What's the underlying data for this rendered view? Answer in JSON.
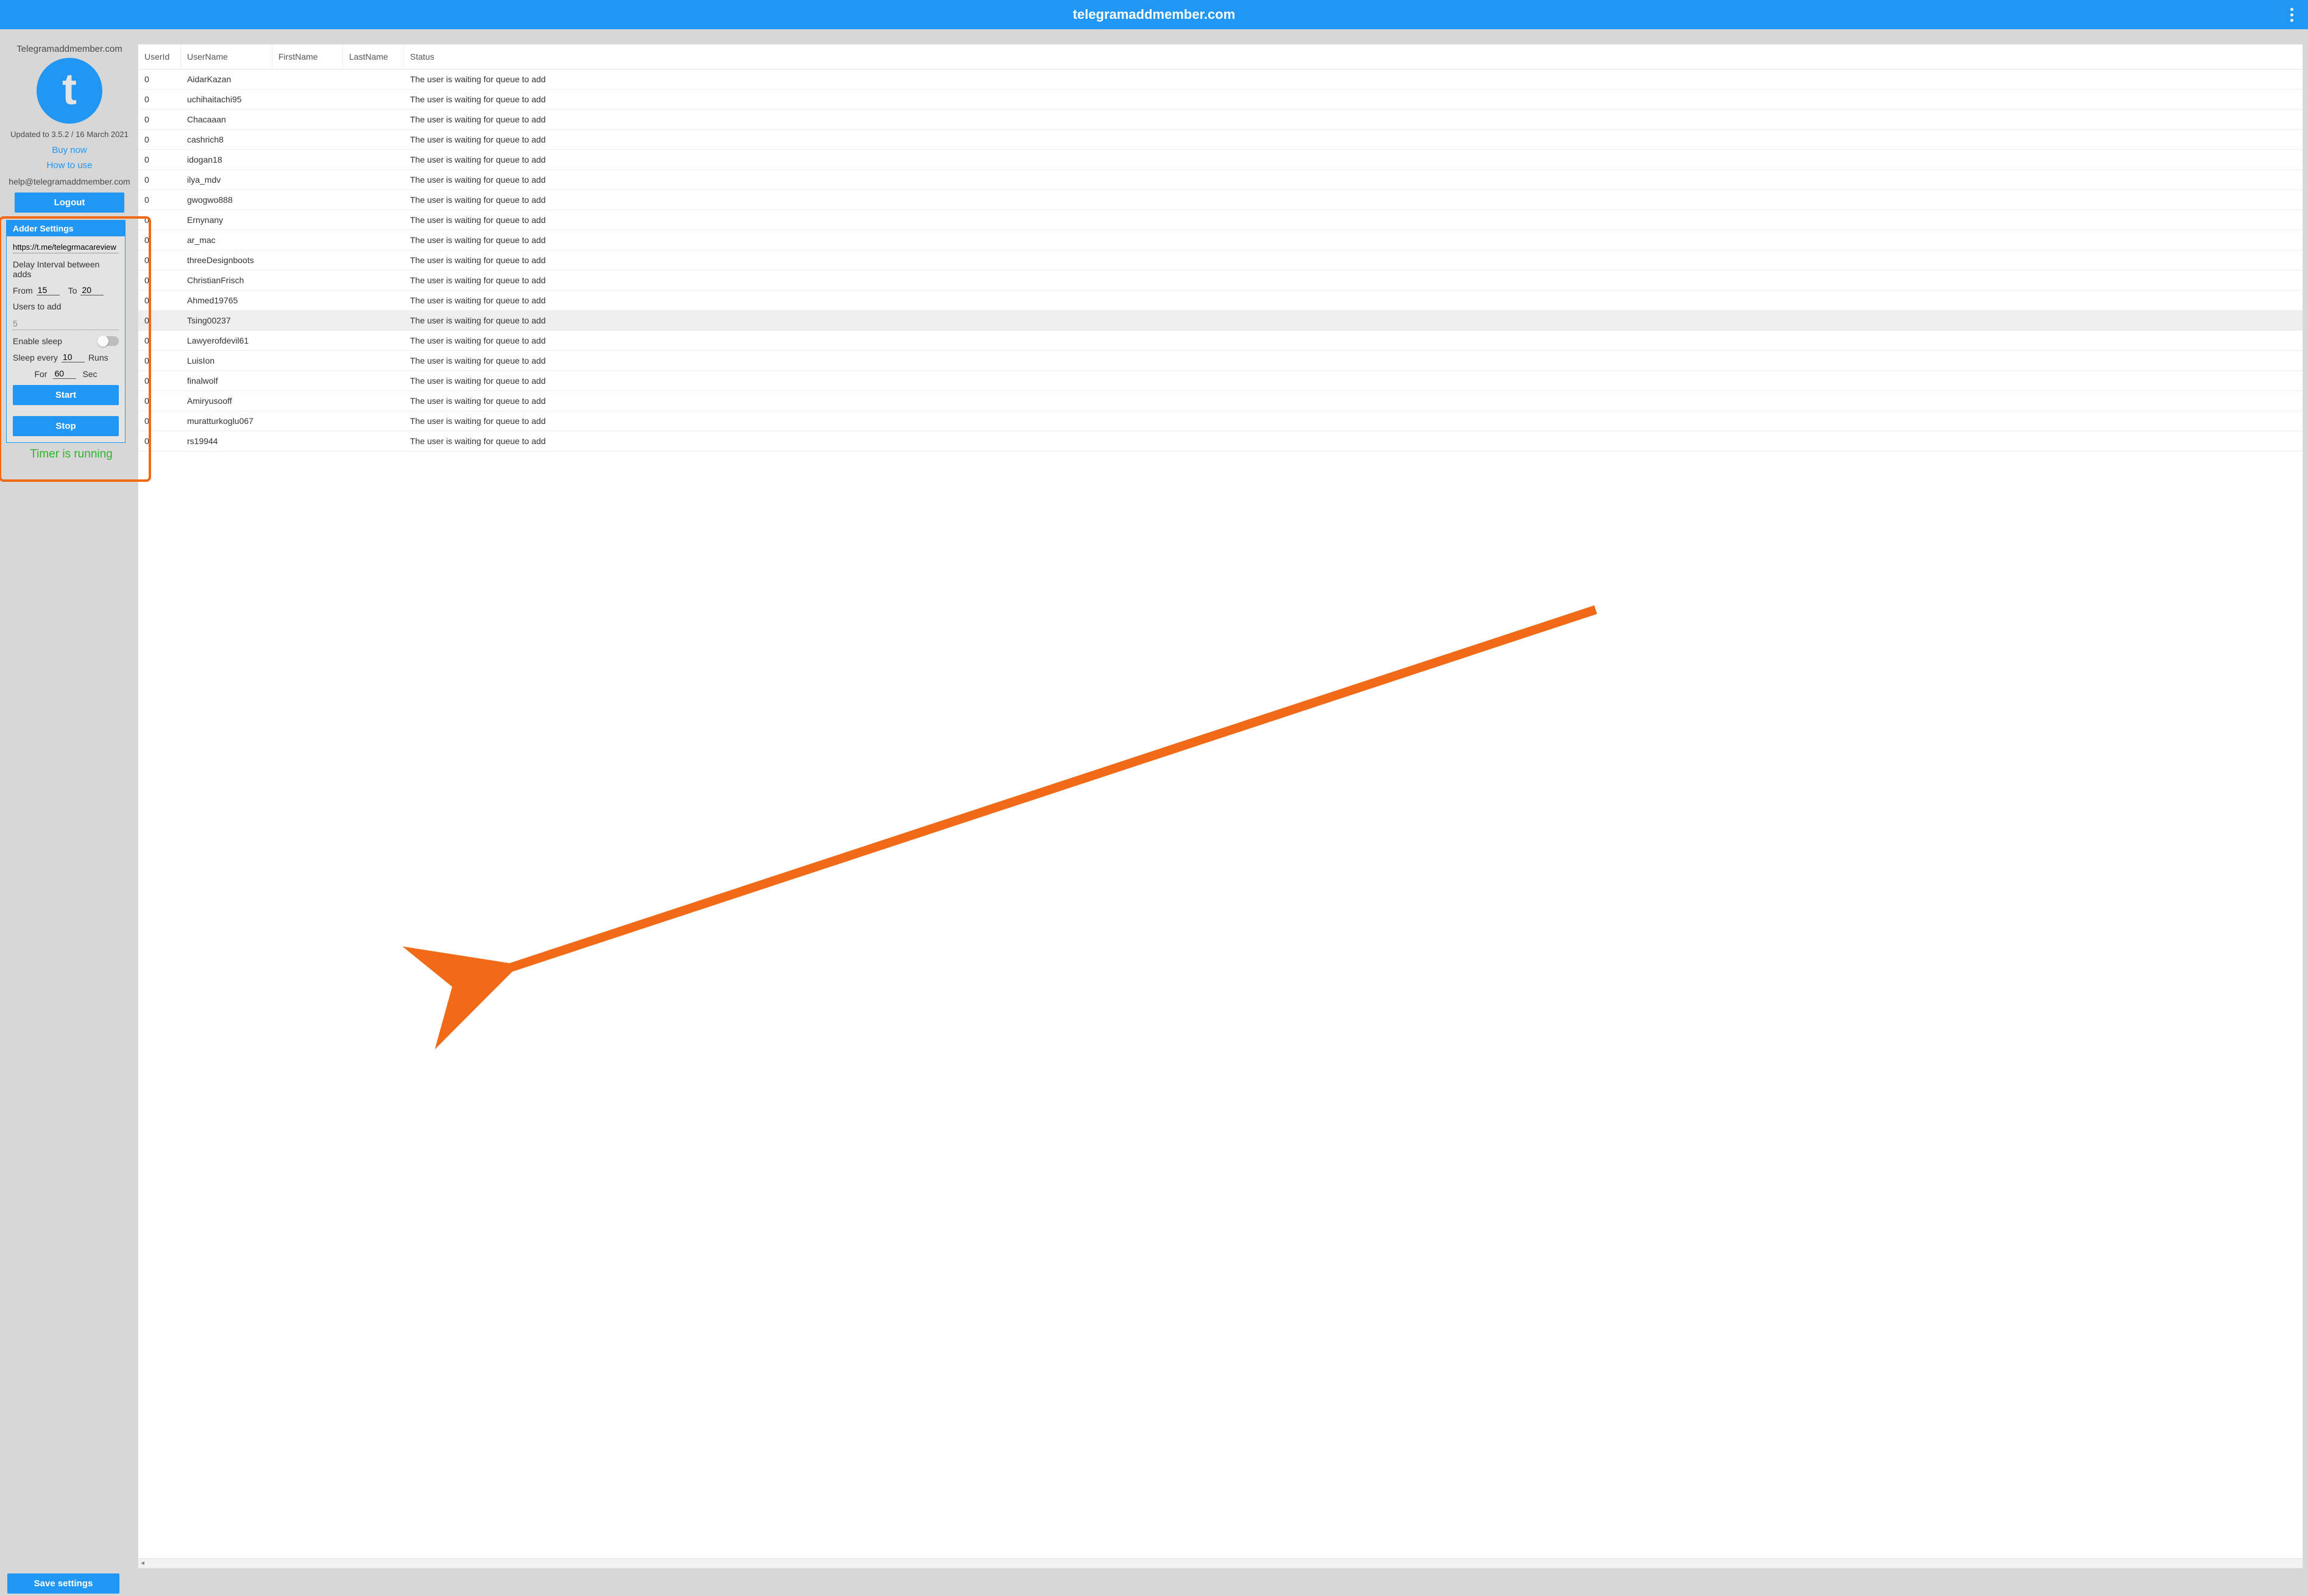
{
  "header": {
    "title": "telegramaddmember.com"
  },
  "sidebar": {
    "brand": "Telegramaddmember.com",
    "version": "Updated to 3.5.2 / 16 March 2021",
    "buy_link": "Buy now",
    "howto_link": "How to use",
    "support_email": "help@telegramaddmember.com",
    "logout_label": "Logout",
    "save_label": "Save settings",
    "timer_status": "Timer is running"
  },
  "adder": {
    "panel_title": "Adder Settings",
    "url": "https://t.me/telegrmacareview",
    "delay_label": "Delay Interval between adds",
    "from_label": "From",
    "to_label": "To",
    "from": "15",
    "to": "20",
    "users_label": "Users to add",
    "users": "5",
    "sleep_label": "Enable sleep",
    "sleep_every_label": "Sleep every",
    "runs_label": "Runs",
    "sleep_every": "10",
    "for_label": "For",
    "sec_label": "Sec",
    "for": "60",
    "start_label": "Start",
    "stop_label": "Stop"
  },
  "table": {
    "columns": {
      "c1": "UserId",
      "c2": "UserName",
      "c3": "FirstName",
      "c4": "LastName",
      "c5": "Status"
    },
    "rows": [
      {
        "id": "0",
        "user": "AidarKazan",
        "fn": "",
        "ln": "",
        "status": "The user is waiting for queue to add",
        "hl": false
      },
      {
        "id": "0",
        "user": "uchihaitachi95",
        "fn": "",
        "ln": "",
        "status": "The user is waiting for queue to add",
        "hl": false
      },
      {
        "id": "0",
        "user": "Chacaaan",
        "fn": "",
        "ln": "",
        "status": "The user is waiting for queue to add",
        "hl": false
      },
      {
        "id": "0",
        "user": "cashrich8",
        "fn": "",
        "ln": "",
        "status": "The user is waiting for queue to add",
        "hl": false
      },
      {
        "id": "0",
        "user": "idogan18",
        "fn": "",
        "ln": "",
        "status": "The user is waiting for queue to add",
        "hl": false
      },
      {
        "id": "0",
        "user": "ilya_mdv",
        "fn": "",
        "ln": "",
        "status": "The user is waiting for queue to add",
        "hl": false
      },
      {
        "id": "0",
        "user": "gwogwo888",
        "fn": "",
        "ln": "",
        "status": "The user is waiting for queue to add",
        "hl": false
      },
      {
        "id": "0",
        "user": "Ernynany",
        "fn": "",
        "ln": "",
        "status": "The user is waiting for queue to add",
        "hl": false
      },
      {
        "id": "0",
        "user": "ar_mac",
        "fn": "",
        "ln": "",
        "status": "The user is waiting for queue to add",
        "hl": false
      },
      {
        "id": "0",
        "user": "threeDesignboots",
        "fn": "",
        "ln": "",
        "status": "The user is waiting for queue to add",
        "hl": false
      },
      {
        "id": "0",
        "user": "ChristianFrisch",
        "fn": "",
        "ln": "",
        "status": "The user is waiting for queue to add",
        "hl": false
      },
      {
        "id": "0",
        "user": "Ahmed19765",
        "fn": "",
        "ln": "",
        "status": "The user is waiting for queue to add",
        "hl": false
      },
      {
        "id": "0",
        "user": "Tsing00237",
        "fn": "",
        "ln": "",
        "status": "The user is waiting for queue to add",
        "hl": true
      },
      {
        "id": "0",
        "user": "Lawyerofdevil61",
        "fn": "",
        "ln": "",
        "status": "The user is waiting for queue to add",
        "hl": false
      },
      {
        "id": "0",
        "user": "LuisIon",
        "fn": "",
        "ln": "",
        "status": "The user is waiting for queue to add",
        "hl": false
      },
      {
        "id": "0",
        "user": "finalwolf",
        "fn": "",
        "ln": "",
        "status": "The user is waiting for queue to add",
        "hl": false
      },
      {
        "id": "0",
        "user": "Amiryusooff",
        "fn": "",
        "ln": "",
        "status": "The user is waiting for queue to add",
        "hl": false
      },
      {
        "id": "0",
        "user": "muratturkoglu067",
        "fn": "",
        "ln": "",
        "status": "The user is waiting for queue to add",
        "hl": false
      },
      {
        "id": "0",
        "user": "rs19944",
        "fn": "",
        "ln": "",
        "status": "The user is waiting for queue to add",
        "hl": false
      }
    ]
  }
}
